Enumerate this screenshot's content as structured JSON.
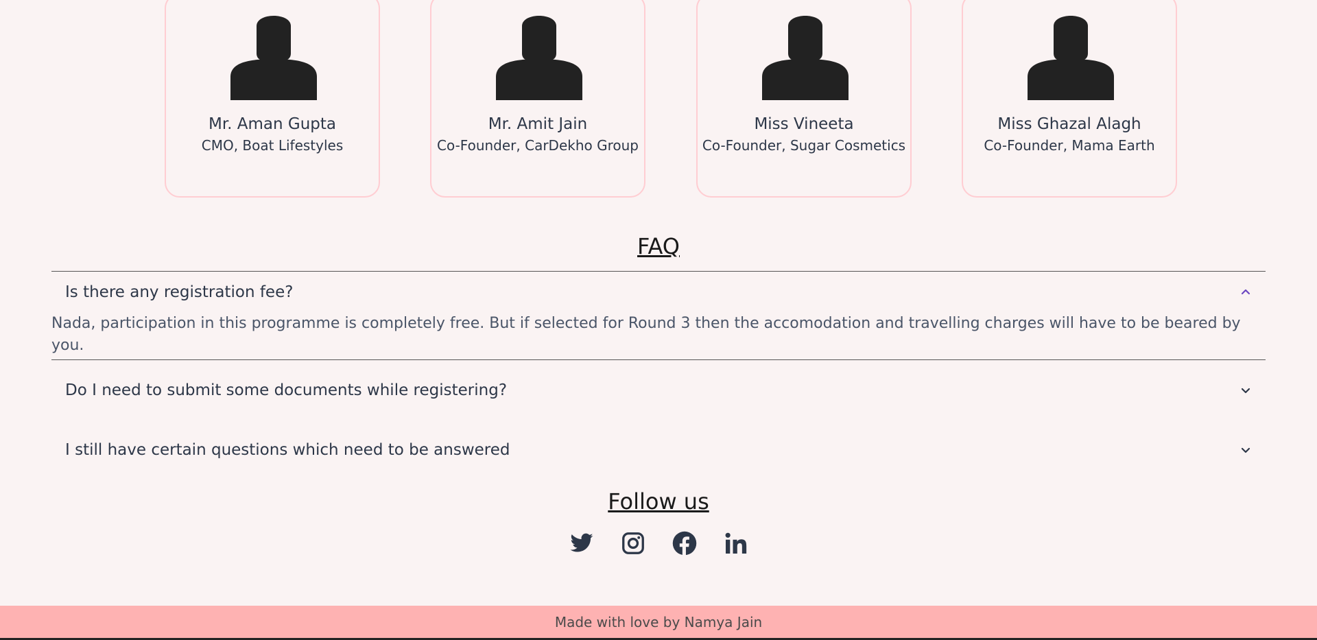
{
  "team": [
    {
      "name": "Mr. Aman Gupta",
      "role": "CMO, Boat Lifestyles",
      "icon": "person-icon"
    },
    {
      "name": "Mr. Amit Jain",
      "role": "Co-Founder, CarDekho Group",
      "icon": "person-icon"
    },
    {
      "name": "Miss Vineeta",
      "role": "Co-Founder, Sugar Cosmetics",
      "icon": "person-icon"
    },
    {
      "name": "Miss Ghazal Alagh",
      "role": "Co-Founder, Mama Earth",
      "icon": "person-icon"
    }
  ],
  "faq": {
    "title": "FAQ",
    "items": [
      {
        "question": "Is there any registration fee?",
        "answer": "Nada, participation in this programme is completely free. But if selected for Round 3 then the accomodation and travelling charges will have to be beared by you.",
        "expanded": true
      },
      {
        "question": "Do I need to submit some documents while registering?",
        "expanded": false
      },
      {
        "question": "I still have certain questions which need to be answered",
        "expanded": false
      }
    ]
  },
  "follow": {
    "title": "Follow us",
    "icons": [
      "twitter-icon",
      "instagram-icon",
      "facebook-icon",
      "linkedin-icon"
    ]
  },
  "footer": {
    "text": "Made with love by Namya Jain"
  },
  "colors": {
    "background": "#faf3f3",
    "card_border": "#ffcdd2",
    "footer_bg": "#feb2b2",
    "accent_chevron": "#6b46c1"
  }
}
